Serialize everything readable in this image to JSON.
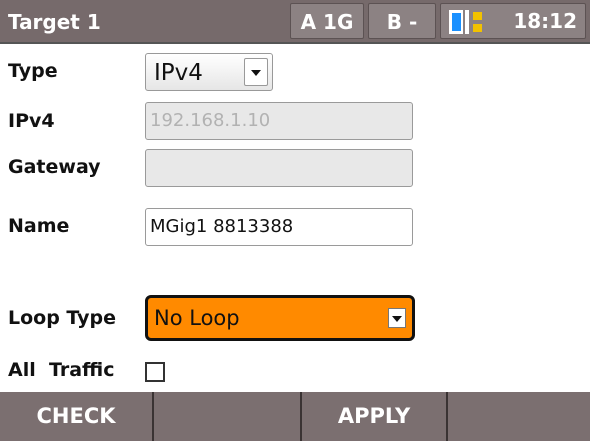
{
  "header": {
    "title": "Target 1",
    "port_a": "A 1G",
    "port_b": "B -",
    "connection_icon": "link-status-icon",
    "time": "18:12"
  },
  "form": {
    "type_label": "Type",
    "type_value": "IPv4",
    "ipv4_label": "IPv4",
    "ipv4_value": "192.168.1.10",
    "gateway_label": "Gateway",
    "gateway_value": "",
    "name_label": "Name",
    "name_value": "MGig1 8813388",
    "loop_type_label": "Loop Type",
    "loop_type_value": "No Loop",
    "all_traffic_label": "All  Traffic",
    "all_traffic_checked": false
  },
  "softkeys": [
    "CHECK",
    "",
    "APPLY",
    ""
  ],
  "colors": {
    "header_bg": "#766a6b",
    "loop_select_bg": "#ff8a00",
    "connection_accent": "#f2c200"
  }
}
